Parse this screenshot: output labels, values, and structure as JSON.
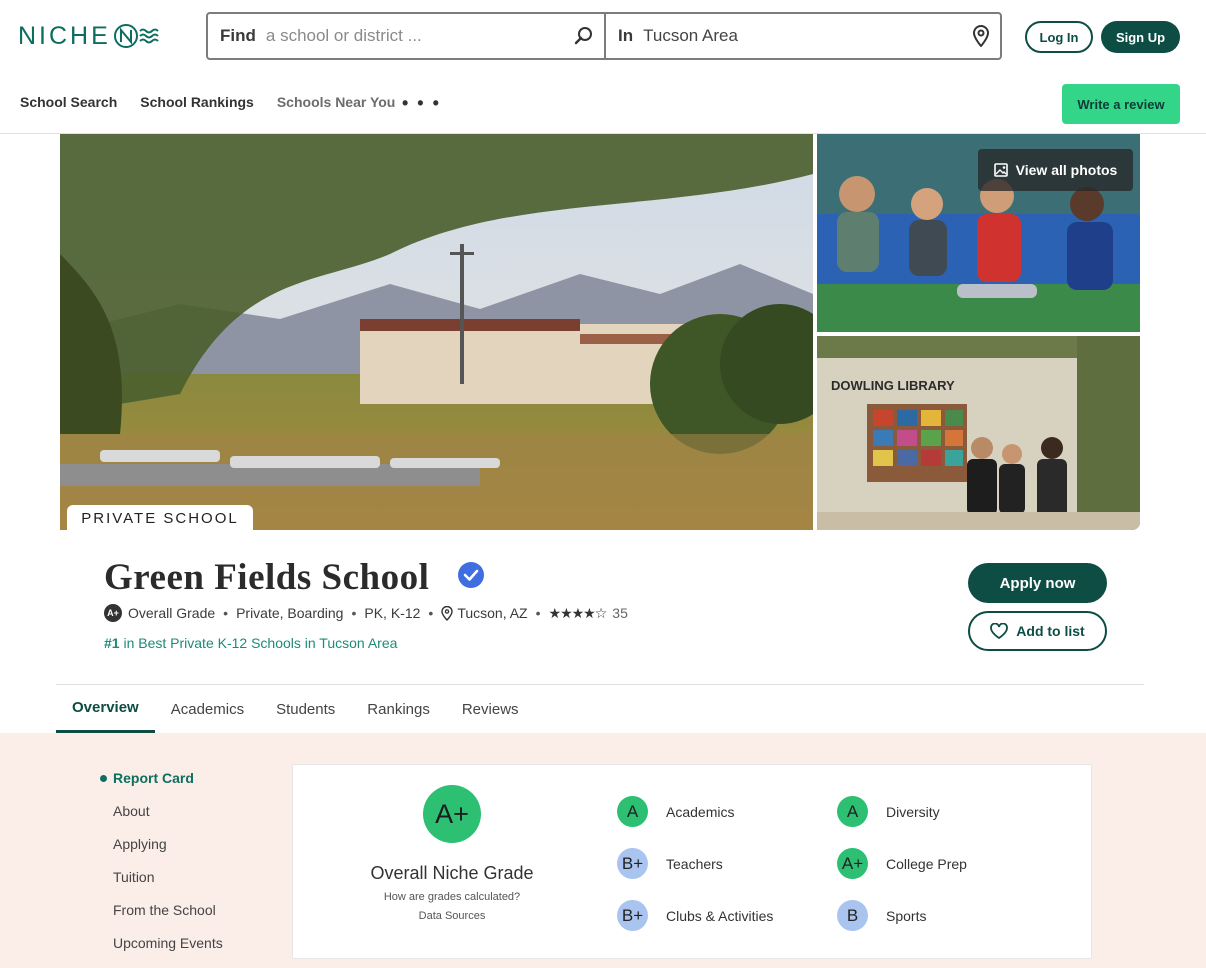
{
  "header": {
    "logo_text": "NICHE",
    "search": {
      "find_label": "Find",
      "find_placeholder": "a school or district ...",
      "in_label": "In",
      "in_value": "Tucson Area"
    },
    "login_label": "Log In",
    "signup_label": "Sign Up",
    "nav": [
      "School Search",
      "School Rankings",
      "Schools Near You"
    ],
    "more_label": "• • •",
    "write_review_label": "Write a review"
  },
  "photos": {
    "view_all_label": "View all photos",
    "badge": "PRIVATE SCHOOL",
    "library_sign": "DOWLING LIBRARY"
  },
  "school": {
    "name": "Green Fields School",
    "overall_grade_mini": "A+",
    "overall_grade_label": "Overall Grade",
    "type": "Private, Boarding",
    "grades": "PK, K-12",
    "location": "Tucson, AZ",
    "stars": "★★★★☆",
    "review_count": "35",
    "rank_number": "#1",
    "rank_text": "in Best Private K-12 Schools in Tucson Area",
    "apply_label": "Apply now",
    "add_list_label": "Add to list"
  },
  "tabs": [
    "Overview",
    "Academics",
    "Students",
    "Rankings",
    "Reviews"
  ],
  "side_nav": [
    "Report Card",
    "About",
    "Applying",
    "Tuition",
    "From the School",
    "Upcoming Events"
  ],
  "report_card": {
    "overall_grade": "A+",
    "overall_label": "Overall Niche Grade",
    "calc_link": "How are grades calculated?",
    "sources_link": "Data Sources",
    "grades": [
      {
        "grade": "A",
        "label": "Academics",
        "color": "#2dbf72"
      },
      {
        "grade": "B+",
        "label": "Teachers",
        "color": "#a9c4ef"
      },
      {
        "grade": "B+",
        "label": "Clubs & Activities",
        "color": "#a9c4ef"
      },
      {
        "grade": "A",
        "label": "Diversity",
        "color": "#2dbf72"
      },
      {
        "grade": "A+",
        "label": "College Prep",
        "color": "#2dbf72"
      },
      {
        "grade": "B",
        "label": "Sports",
        "color": "#a9c4ef"
      }
    ]
  },
  "colors": {
    "brand_dark": "#0d4d43",
    "brand_green": "#33d689",
    "link_green": "#1c8b79",
    "section_bg": "#fbeee9"
  }
}
